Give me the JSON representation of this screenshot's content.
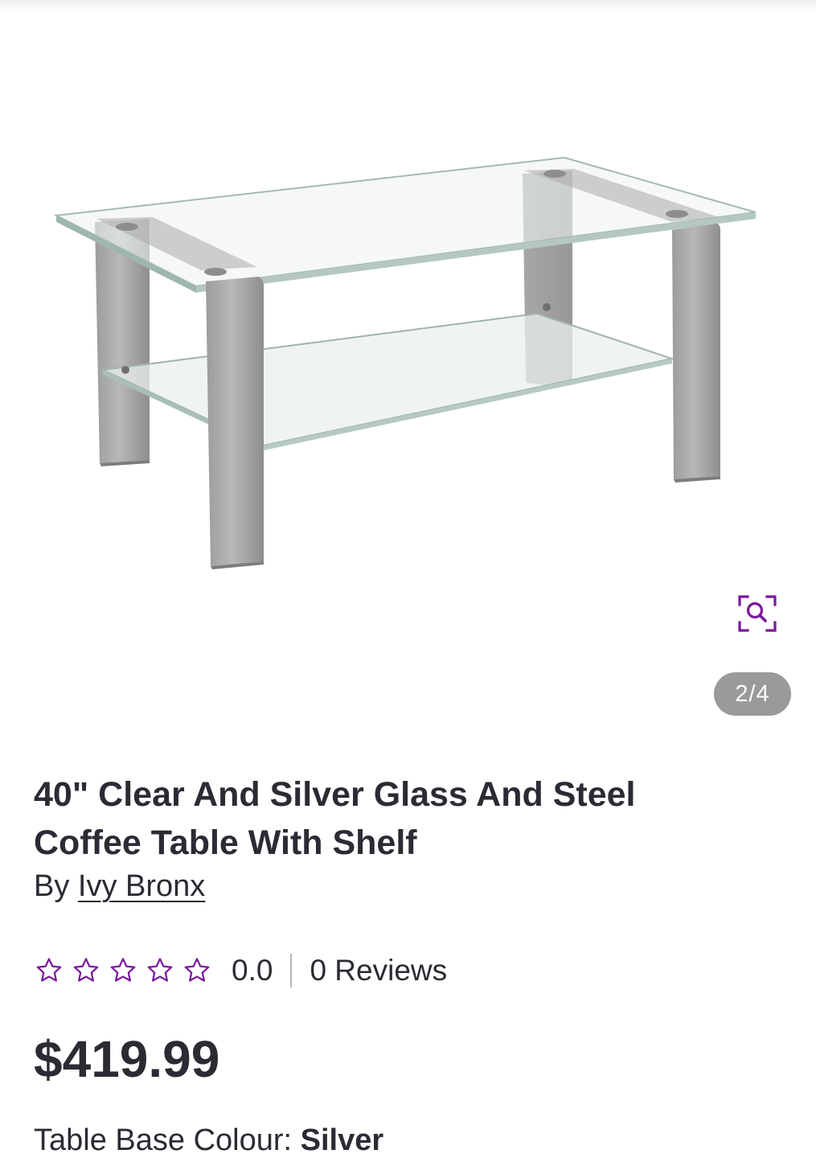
{
  "gallery": {
    "image_alt": "Glass and steel coffee table with shelf",
    "zoom_icon": "zoom-search-icon",
    "counter": "2/4"
  },
  "product": {
    "title_line1": "40\" Clear And Silver Glass And Steel",
    "title_line2": "Coffee Table With Shelf",
    "by_prefix": "By",
    "brand": "Ivy Bronx",
    "rating": {
      "stars_total": 5,
      "stars_filled": 0,
      "value": "0.0",
      "reviews": "0 Reviews"
    },
    "price": "$419.99",
    "option": {
      "label": "Table Base Colour:",
      "value": "Silver"
    }
  },
  "colors": {
    "accent": "#7b189f",
    "text": "#2d2a33",
    "counter_bg": "#9a9a9a"
  }
}
